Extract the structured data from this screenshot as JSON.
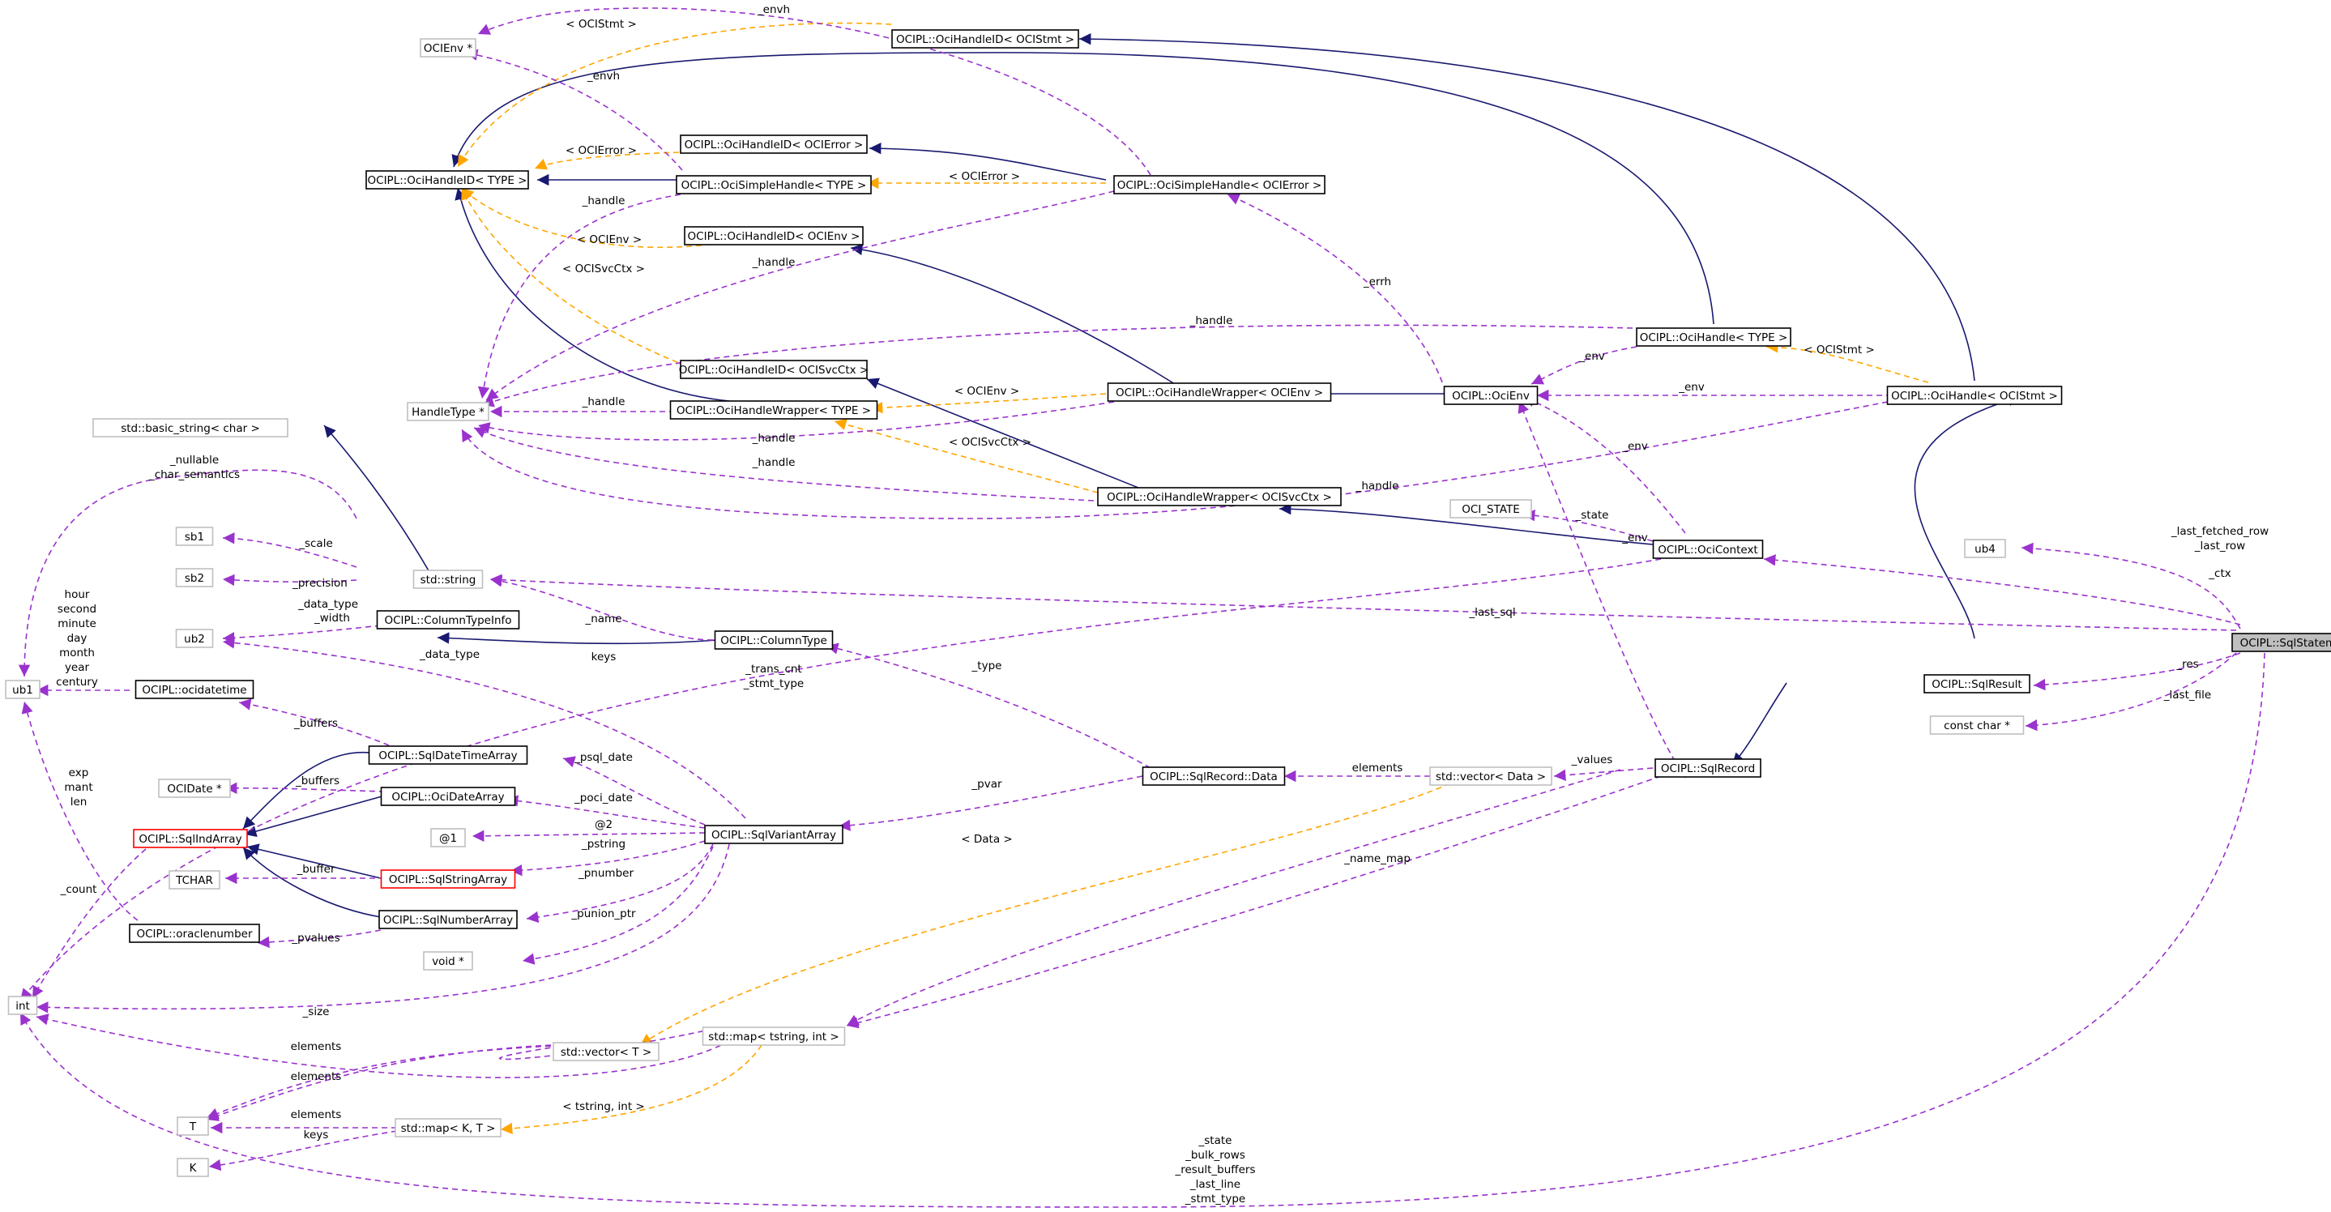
{
  "colors": {
    "inherit": "#191970",
    "usage": "#9a32cd",
    "template": "#ffa500",
    "box_normal": "#000000",
    "box_undocumented": "#bfbfbf",
    "box_red": "#ff0000",
    "box_focus_fill": "#bfbfbf"
  },
  "nodes": [
    {
      "id": "OCIEnvPtr",
      "label": "OCIEnv *",
      "style": "gray"
    },
    {
      "id": "HIDStmt",
      "label": "OCIPL::OciHandleID< OCIStmt >",
      "style": "black"
    },
    {
      "id": "HIDErr",
      "label": "OCIPL::OciHandleID< OCIError >",
      "style": "black"
    },
    {
      "id": "HIDType",
      "label": "OCIPL::OciHandleID< TYPE >",
      "style": "black"
    },
    {
      "id": "SimpleType",
      "label": "OCIPL::OciSimpleHandle< TYPE >",
      "style": "black"
    },
    {
      "id": "SimpleErr",
      "label": "OCIPL::OciSimpleHandle< OCIError >",
      "style": "black"
    },
    {
      "id": "HIDEnv",
      "label": "OCIPL::OciHandleID< OCIEnv >",
      "style": "black"
    },
    {
      "id": "HandleType",
      "label": "OCIPL::OciHandle< TYPE >",
      "style": "black"
    },
    {
      "id": "HIDSvc",
      "label": "OCIPL::OciHandleID< OCISvcCtx >",
      "style": "black"
    },
    {
      "id": "HandleTypePtr",
      "label": "HandleType *",
      "style": "gray"
    },
    {
      "id": "WrapType",
      "label": "OCIPL::OciHandleWrapper< TYPE >",
      "style": "black"
    },
    {
      "id": "WrapEnv",
      "label": "OCIPL::OciHandleWrapper< OCIEnv >",
      "style": "black"
    },
    {
      "id": "OciEnv",
      "label": "OCIPL::OciEnv",
      "style": "black"
    },
    {
      "id": "HandleStmt",
      "label": "OCIPL::OciHandle< OCIStmt >",
      "style": "black"
    },
    {
      "id": "BasicString",
      "label": "std::basic_string< char >",
      "style": "gray"
    },
    {
      "id": "WrapSvc",
      "label": "OCIPL::OciHandleWrapper< OCISvcCtx >",
      "style": "black"
    },
    {
      "id": "OCI_STATE",
      "label": "OCI_STATE",
      "style": "gray"
    },
    {
      "id": "sb1",
      "label": "sb1",
      "style": "gray"
    },
    {
      "id": "ub4",
      "label": "ub4",
      "style": "gray"
    },
    {
      "id": "OciContext",
      "label": "OCIPL::OciContext",
      "style": "black"
    },
    {
      "id": "sb2",
      "label": "sb2",
      "style": "gray"
    },
    {
      "id": "stdstring",
      "label": "std::string",
      "style": "gray"
    },
    {
      "id": "ColumnTypeInfo",
      "label": "OCIPL::ColumnTypeInfo",
      "style": "black"
    },
    {
      "id": "ub2",
      "label": "ub2",
      "style": "gray"
    },
    {
      "id": "ColumnType",
      "label": "OCIPL::ColumnType",
      "style": "black"
    },
    {
      "id": "SqlStatement",
      "label": "OCIPL::SqlStatement",
      "style": "focus"
    },
    {
      "id": "ub1",
      "label": "ub1",
      "style": "gray"
    },
    {
      "id": "ocidatetime",
      "label": "OCIPL::ocidatetime",
      "style": "black"
    },
    {
      "id": "SqlResult",
      "label": "OCIPL::SqlResult",
      "style": "black"
    },
    {
      "id": "constchar",
      "label": "const char *",
      "style": "gray"
    },
    {
      "id": "SqlDateTimeArray",
      "label": "OCIPL::SqlDateTimeArray",
      "style": "black"
    },
    {
      "id": "OCIDatePtr",
      "label": "OCIDate *",
      "style": "gray"
    },
    {
      "id": "OciDateArray",
      "label": "OCIPL::OciDateArray",
      "style": "black"
    },
    {
      "id": "SqlRecordData",
      "label": "OCIPL::SqlRecord::Data",
      "style": "black"
    },
    {
      "id": "vectorData",
      "label": "std::vector< Data >",
      "style": "gray"
    },
    {
      "id": "SqlRecord",
      "label": "OCIPL::SqlRecord",
      "style": "black"
    },
    {
      "id": "SqlIndArray",
      "label": "OCIPL::SqlIndArray",
      "style": "red"
    },
    {
      "id": "at1",
      "label": "@1",
      "style": "gray"
    },
    {
      "id": "SqlVariantArray",
      "label": "OCIPL::SqlVariantArray",
      "style": "black"
    },
    {
      "id": "TCHAR",
      "label": "TCHAR",
      "style": "gray"
    },
    {
      "id": "SqlStringArray",
      "label": "OCIPL::SqlStringArray",
      "style": "red"
    },
    {
      "id": "oraclenumber",
      "label": "OCIPL::oraclenumber",
      "style": "black"
    },
    {
      "id": "SqlNumberArray",
      "label": "OCIPL::SqlNumberArray",
      "style": "black"
    },
    {
      "id": "voidPtr",
      "label": "void *",
      "style": "gray"
    },
    {
      "id": "int",
      "label": "int",
      "style": "gray"
    },
    {
      "id": "maptstring",
      "label": "std::map< tstring, int >",
      "style": "gray"
    },
    {
      "id": "vectorT",
      "label": "std::vector< T >",
      "style": "gray"
    },
    {
      "id": "T",
      "label": "T",
      "style": "gray"
    },
    {
      "id": "mapKT",
      "label": "std::map< K, T >",
      "style": "gray"
    },
    {
      "id": "K",
      "label": "K",
      "style": "gray"
    }
  ],
  "edge_labels": [
    {
      "id": "l_envh_top",
      "text": "_envh"
    },
    {
      "id": "l_ocistmt_top",
      "text": "< OCIStmt >"
    },
    {
      "id": "l_envh2",
      "text": "_envh"
    },
    {
      "id": "l_ocierror1",
      "text": "< OCIError >"
    },
    {
      "id": "l_ocierror2",
      "text": "< OCIError >"
    },
    {
      "id": "l_handle1",
      "text": "_handle"
    },
    {
      "id": "l_ocienv1",
      "text": "< OCIEnv >"
    },
    {
      "id": "l_handle2",
      "text": "_handle"
    },
    {
      "id": "l_ocisvcctx1",
      "text": "< OCISvcCtx >"
    },
    {
      "id": "l_errh",
      "text": "_errh"
    },
    {
      "id": "l_handle3",
      "text": "_handle"
    },
    {
      "id": "l_env1",
      "text": "_env"
    },
    {
      "id": "l_ocistmt2",
      "text": "< OCIStmt >"
    },
    {
      "id": "l_ocienv2",
      "text": "< OCIEnv >"
    },
    {
      "id": "l_handle4",
      "text": "_handle"
    },
    {
      "id": "l_env2",
      "text": "_env"
    },
    {
      "id": "l_handle5",
      "text": "_handle"
    },
    {
      "id": "l_ocisvcctx2",
      "text": "< OCISvcCtx >"
    },
    {
      "id": "l_env3",
      "text": "_env"
    },
    {
      "id": "l_handle6",
      "text": "_handle"
    },
    {
      "id": "l_handle7",
      "text": "_handle"
    },
    {
      "id": "l_nullable1",
      "text": "_nullable"
    },
    {
      "id": "l_nullable2",
      "text": "_char_semantics"
    },
    {
      "id": "l_state",
      "text": "_state"
    },
    {
      "id": "l_lastfetched1",
      "text": "_last_fetched_row"
    },
    {
      "id": "l_lastfetched2",
      "text": "_last_row"
    },
    {
      "id": "l_scale",
      "text": "_scale"
    },
    {
      "id": "l_env4",
      "text": "_env"
    },
    {
      "id": "l_ctx",
      "text": "_ctx"
    },
    {
      "id": "l_precision",
      "text": "_precision"
    },
    {
      "id": "l_datatype1",
      "text": "_data_type"
    },
    {
      "id": "l_width",
      "text": "_width"
    },
    {
      "id": "l_lastsql",
      "text": "_last_sql"
    },
    {
      "id": "l_hour1",
      "text": "hour"
    },
    {
      "id": "l_hour2",
      "text": "second"
    },
    {
      "id": "l_hour3",
      "text": "minute"
    },
    {
      "id": "l_hour4",
      "text": "day"
    },
    {
      "id": "l_hour5",
      "text": "month"
    },
    {
      "id": "l_hour6",
      "text": "year"
    },
    {
      "id": "l_hour7",
      "text": "century"
    },
    {
      "id": "l_name",
      "text": "_name"
    },
    {
      "id": "l_datatype2",
      "text": "_data_type"
    },
    {
      "id": "l_keys1",
      "text": "keys"
    },
    {
      "id": "l_res",
      "text": "_res"
    },
    {
      "id": "l_transcnt1",
      "text": "_trans_cnt"
    },
    {
      "id": "l_transcnt2",
      "text": "_stmt_type"
    },
    {
      "id": "l_type",
      "text": "_type"
    },
    {
      "id": "l_lastfile",
      "text": "_last_file"
    },
    {
      "id": "l_buffers1",
      "text": "_buffers"
    },
    {
      "id": "l_psqldate",
      "text": "_psql_date"
    },
    {
      "id": "l_elements1",
      "text": "elements"
    },
    {
      "id": "l_values",
      "text": "_values"
    },
    {
      "id": "l_buffers2",
      "text": "_buffers"
    },
    {
      "id": "l_pocidate",
      "text": "_poci_date"
    },
    {
      "id": "l_pvar",
      "text": "_pvar"
    },
    {
      "id": "l_exp1",
      "text": "exp"
    },
    {
      "id": "l_exp2",
      "text": "mant"
    },
    {
      "id": "l_exp3",
      "text": "len"
    },
    {
      "id": "l_at2",
      "text": "@2"
    },
    {
      "id": "l_pstring",
      "text": "_pstring"
    },
    {
      "id": "l_data",
      "text": "< Data >"
    },
    {
      "id": "l_buffer",
      "text": "_buffer"
    },
    {
      "id": "l_namemap",
      "text": "_name_map"
    },
    {
      "id": "l_count",
      "text": "_count"
    },
    {
      "id": "l_pnumber",
      "text": "_pnumber"
    },
    {
      "id": "l_pvalues",
      "text": "_pvalues"
    },
    {
      "id": "l_punion",
      "text": "_punion_ptr"
    },
    {
      "id": "l_size",
      "text": "_size"
    },
    {
      "id": "l_elements2",
      "text": "elements"
    },
    {
      "id": "l_elements3",
      "text": "elements"
    },
    {
      "id": "l_elements4",
      "text": "elements"
    },
    {
      "id": "l_tstringint",
      "text": "< tstring, int >"
    },
    {
      "id": "l_keys2",
      "text": "keys"
    },
    {
      "id": "l_state1",
      "text": "_state"
    },
    {
      "id": "l_state2",
      "text": "_bulk_rows"
    },
    {
      "id": "l_state3",
      "text": "_result_buffers"
    },
    {
      "id": "l_state4",
      "text": "_last_line"
    },
    {
      "id": "l_state5",
      "text": "_stmt_type"
    }
  ]
}
